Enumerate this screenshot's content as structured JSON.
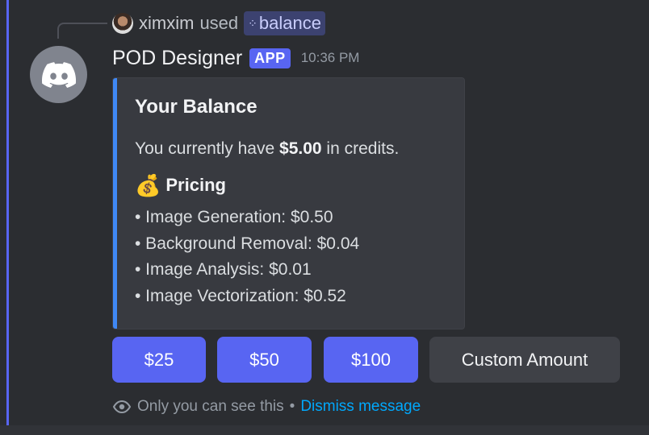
{
  "reply": {
    "username": "ximxim",
    "used_text": "used",
    "command": "balance"
  },
  "message": {
    "bot_name": "POD Designer",
    "badge": "APP",
    "timestamp": "10:36 PM"
  },
  "embed": {
    "title": "Your Balance",
    "desc_prefix": "You currently have ",
    "desc_amount": "$5.00",
    "desc_suffix": " in credits.",
    "field_icon": "💰",
    "field_name": "Pricing",
    "items": [
      "• Image Generation: $0.50",
      "• Background Removal: $0.04",
      "• Image Analysis: $0.01",
      "• Image Vectorization: $0.52"
    ],
    "stripe_color": "#3f88f5"
  },
  "buttons": {
    "b25": "$25",
    "b50": "$50",
    "b100": "$100",
    "custom": "Custom Amount"
  },
  "ephemeral": {
    "note": "Only you can see this",
    "separator": "•",
    "dismiss": "Dismiss message"
  },
  "colors": {
    "blurple": "#5865f2",
    "background": "#2b2d31",
    "link": "#00a8fc"
  },
  "icons": {
    "bot_avatar": "discord-logo-icon",
    "command": "slash-command-icon",
    "visibility": "eye-icon"
  }
}
